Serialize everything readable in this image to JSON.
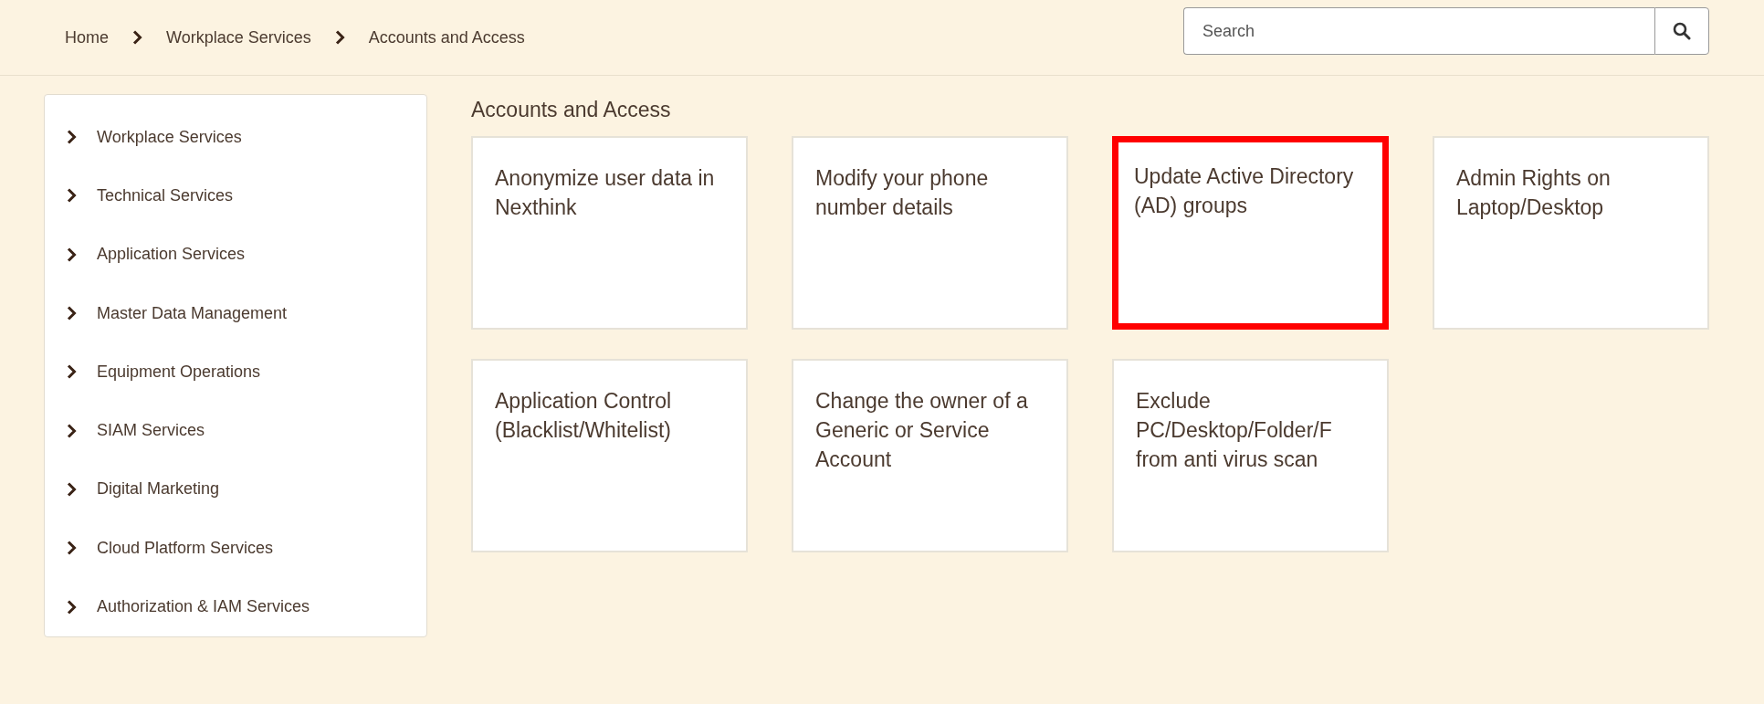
{
  "breadcrumb": [
    {
      "label": "Home"
    },
    {
      "label": "Workplace Services"
    },
    {
      "label": "Accounts and Access"
    }
  ],
  "search": {
    "placeholder": "Search"
  },
  "sidebar": {
    "items": [
      {
        "label": "Workplace Services"
      },
      {
        "label": "Technical Services"
      },
      {
        "label": "Application Services"
      },
      {
        "label": "Master Data Management"
      },
      {
        "label": "Equipment Operations"
      },
      {
        "label": "SIAM Services"
      },
      {
        "label": "Digital Marketing"
      },
      {
        "label": "Cloud Platform Services"
      },
      {
        "label": "Authorization & IAM Services"
      }
    ]
  },
  "section": {
    "title": "Accounts and Access",
    "cards": [
      {
        "label": "Anonymize user data in Nexthink",
        "selected": false
      },
      {
        "label": "Modify your phone number details",
        "selected": false
      },
      {
        "label": "Update Active Directory (AD) groups",
        "selected": true
      },
      {
        "label": "Admin Rights on Laptop/Desktop",
        "selected": false
      },
      {
        "label": "Application Control (Blacklist/Whitelist)",
        "selected": false
      },
      {
        "label": "Change the owner of a Generic or Service Account",
        "selected": false
      },
      {
        "label": "Exclude PC/Desktop/Folder/F from anti virus scan",
        "selected": false
      }
    ]
  }
}
